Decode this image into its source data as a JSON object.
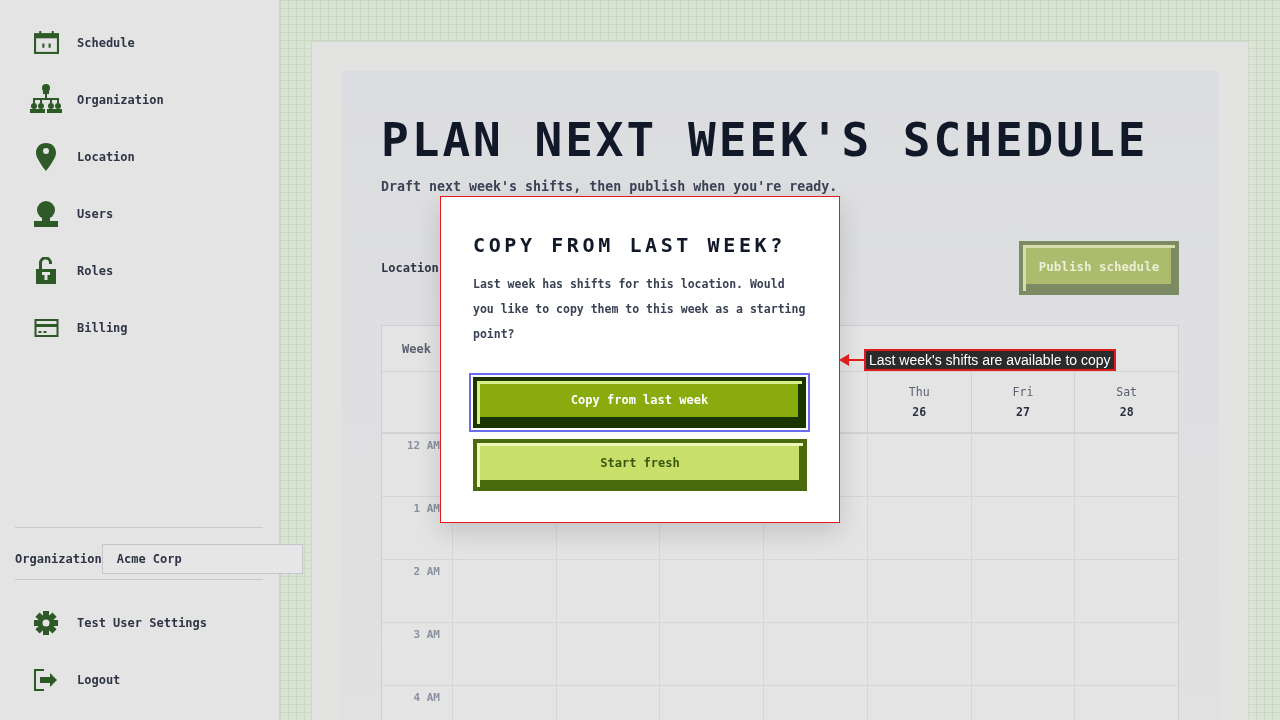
{
  "sidebar": {
    "nav_items": [
      {
        "label": "Schedule"
      },
      {
        "label": "Organization"
      },
      {
        "label": "Location"
      },
      {
        "label": "Users"
      },
      {
        "label": "Roles"
      },
      {
        "label": "Billing"
      }
    ],
    "organization": {
      "label": "Organization",
      "value": "Acme Corp"
    },
    "footer_items": [
      {
        "label": "Test User Settings"
      },
      {
        "label": "Logout"
      }
    ]
  },
  "page": {
    "title": "PLAN NEXT WEEK'S SCHEDULE",
    "subtitle": "Draft next week's shifts, then publish when you're ready.",
    "location_label": "Location",
    "publish_button": {
      "label": "Publish schedule",
      "disabled": true
    }
  },
  "calendar": {
    "week_label": "Week",
    "days": [
      {
        "name": "Thu",
        "date": "26"
      },
      {
        "name": "Fri",
        "date": "27"
      },
      {
        "name": "Sat",
        "date": "28"
      }
    ],
    "hours": [
      "12 AM",
      "1 AM",
      "2 AM",
      "3 AM",
      "4 AM"
    ]
  },
  "dialog": {
    "title": "COPY FROM LAST WEEK?",
    "message": "Last week has shifts for this location. Would you like to copy them to this week as a starting point?",
    "buttons": [
      {
        "label": "Copy from last week",
        "kind": "primary",
        "focused": true
      },
      {
        "label": "Start fresh",
        "kind": "secondary",
        "focused": false
      }
    ]
  },
  "callout": {
    "text": "Last week's shifts are available to copy"
  }
}
